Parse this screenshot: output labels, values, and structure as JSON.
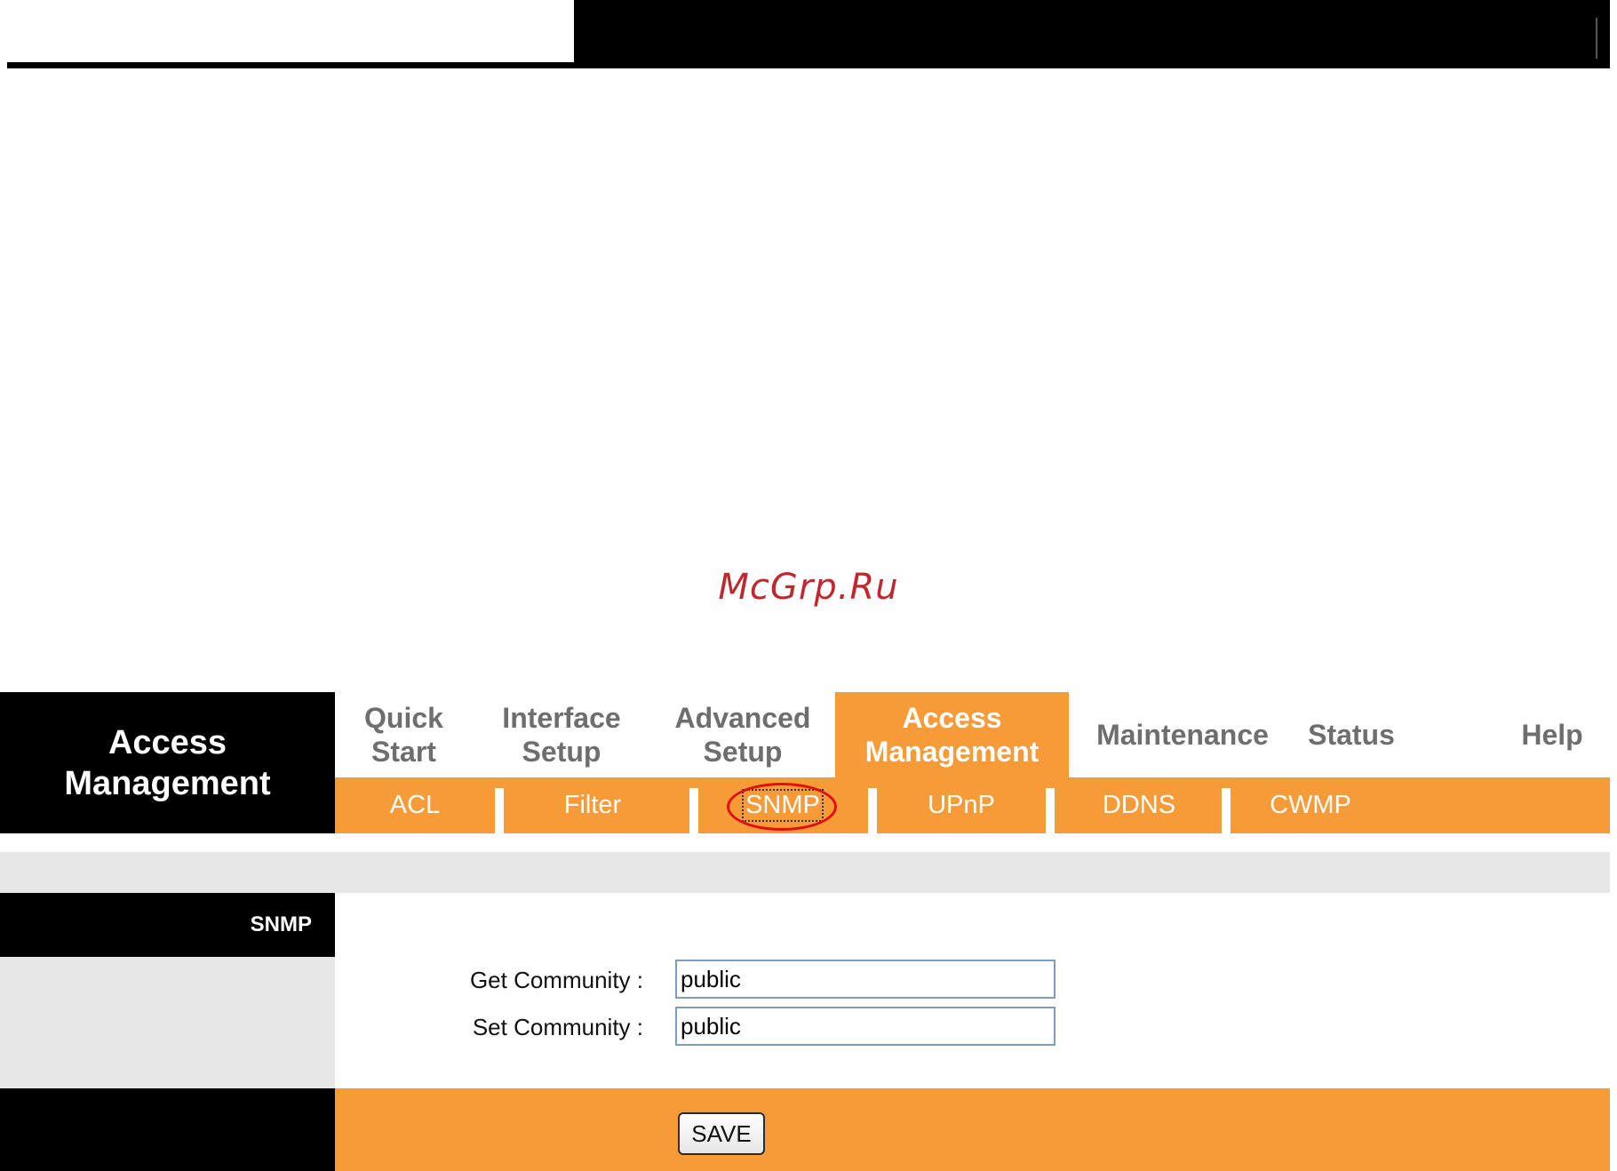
{
  "watermark": "McGrp.Ru",
  "header": {
    "brand_line1": "Access",
    "brand_line2": "Management"
  },
  "main_nav": [
    {
      "line1": "Quick",
      "line2": "Start"
    },
    {
      "line1": "Interface",
      "line2": "Setup"
    },
    {
      "line1": "Advanced",
      "line2": "Setup"
    },
    {
      "line1": "Access",
      "line2": "Management",
      "active": true
    },
    {
      "line1": "Maintenance"
    },
    {
      "line1": "Status"
    },
    {
      "line1": "Help"
    }
  ],
  "sub_nav": [
    "ACL",
    "Filter",
    "SNMP",
    "UPnP",
    "DDNS",
    "CWMP"
  ],
  "section": {
    "title": "SNMP"
  },
  "form": {
    "get_community_label": "Get Community :",
    "get_community_value": "public",
    "set_community_label": "Set Community :",
    "set_community_value": "public"
  },
  "footer": {
    "save_label": "SAVE"
  },
  "colors": {
    "accent": "#f79a38",
    "highlight_circle": "#e01010"
  }
}
